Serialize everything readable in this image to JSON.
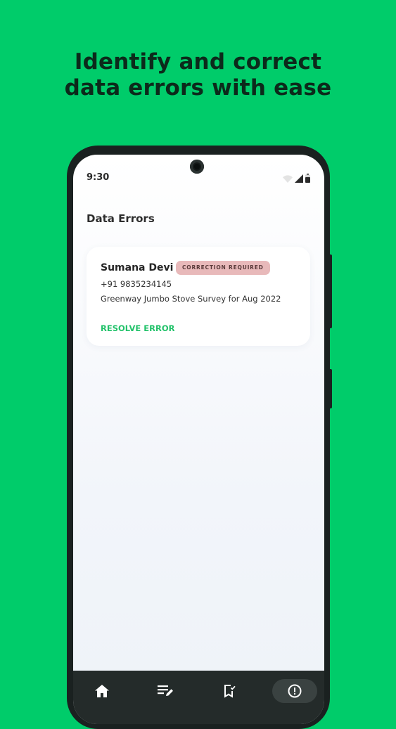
{
  "headline": {
    "line1": "Identify and correct",
    "line2": "data errors with ease"
  },
  "status_bar": {
    "time": "9:30"
  },
  "page": {
    "title": "Data Errors"
  },
  "error_card": {
    "name": "Sumana Devi",
    "badge": "CORRECTION REQUIRED",
    "phone": "+91 9835234145",
    "survey": "Greenway Jumbo Stove Survey for Aug 2022",
    "action": "RESOLVE ERROR"
  },
  "nav": {
    "items": [
      {
        "icon": "home-icon"
      },
      {
        "icon": "edit-list-icon"
      },
      {
        "icon": "bookmark-check-icon"
      },
      {
        "icon": "error-alert-icon",
        "active": true
      }
    ]
  },
  "colors": {
    "background": "#00CC6A",
    "accent_green": "#22C26A",
    "badge_bg": "#E8B9BA",
    "nav_bg": "#242B2A"
  }
}
